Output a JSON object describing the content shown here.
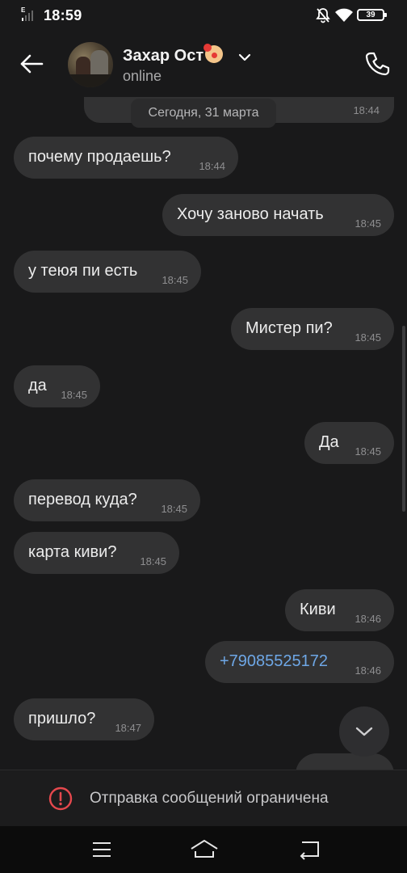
{
  "status_bar": {
    "network": "E",
    "time": "18:59",
    "battery": "39"
  },
  "header": {
    "contact_name": "Захар Ост",
    "contact_emoji": "clown-face",
    "contact_status": "online"
  },
  "chat": {
    "previous_message_time": "18:44",
    "date_separator": "Сегодня, 31 марта",
    "messages": [
      {
        "direction": "incoming",
        "text": "почему продаешь?",
        "time": "18:44"
      },
      {
        "direction": "outgoing",
        "text": "Хочу заново начать",
        "time": "18:45"
      },
      {
        "direction": "incoming",
        "text": "у теюя пи есть",
        "time": "18:45"
      },
      {
        "direction": "outgoing",
        "text": "Мистер пи?",
        "time": "18:45"
      },
      {
        "direction": "incoming",
        "text": "да",
        "time": "18:45"
      },
      {
        "direction": "outgoing",
        "text": "Да",
        "time": "18:45"
      },
      {
        "direction": "incoming",
        "text": "перевод куда?",
        "time": "18:45"
      },
      {
        "direction": "incoming",
        "text": "карта киви?",
        "time": "18:45"
      },
      {
        "direction": "outgoing",
        "text": "Киви",
        "time": "18:46"
      },
      {
        "direction": "outgoing",
        "text": "+79085525172",
        "time": "18:46",
        "is_link": true
      },
      {
        "direction": "incoming",
        "text": "пришло?",
        "time": "18:47"
      }
    ]
  },
  "restriction": {
    "text": "Отправка сообщений ограничена"
  },
  "icons": {
    "back": "arrow-left-icon",
    "call": "phone-icon",
    "expand": "chevron-down-icon",
    "scroll_down": "chevron-down-icon",
    "warning": "exclamation-circle-icon",
    "nav_menu": "menu-icon",
    "nav_home": "home-icon",
    "nav_back": "back-icon"
  },
  "colors": {
    "background": "#19191a",
    "bubble": "#323233",
    "link": "#6ea7e6",
    "warning": "#e5484d"
  }
}
